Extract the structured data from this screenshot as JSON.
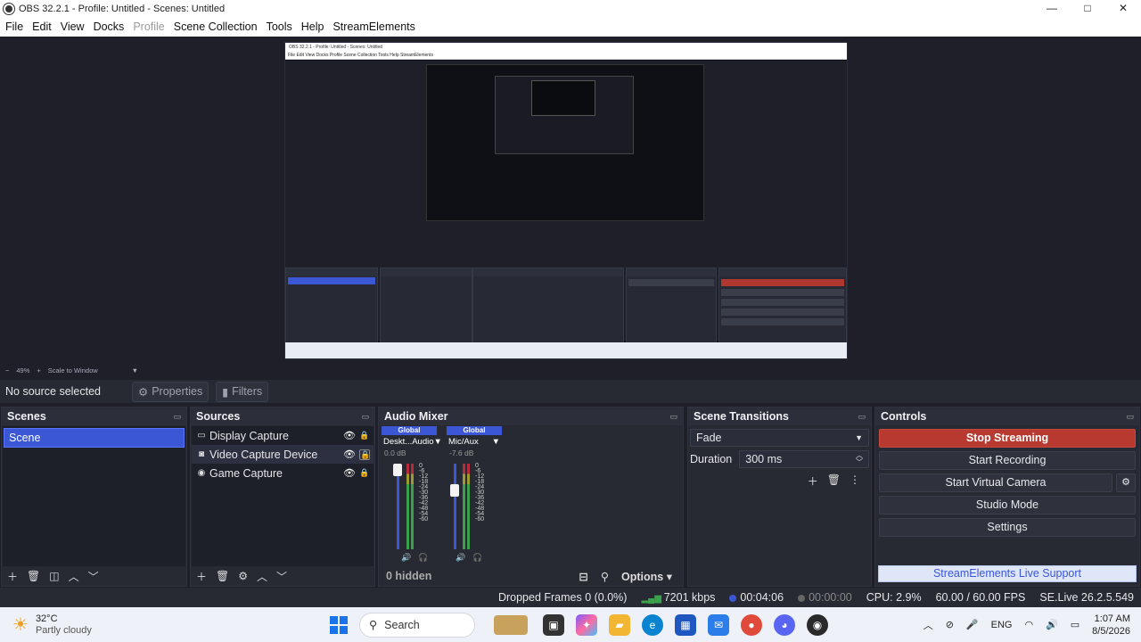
{
  "window": {
    "title": "OBS 32.2.1 - Profile: Untitled - Scenes: Untitled",
    "minimize": "—",
    "maximize": "□",
    "close": "✕"
  },
  "menu": [
    "File",
    "Edit",
    "View",
    "Docks",
    "Profile",
    "Scene Collection",
    "Tools",
    "Help",
    "StreamElements"
  ],
  "preview": {
    "zoom": "49%",
    "scale_mode": "Scale to Window",
    "nested_title": "OBS 32.2.1 - Profile: Untitled - Scenes: Untitled",
    "nested_menu": "File  Edit  View  Docks  Profile  Scene Collection  Tools  Help  StreamElements"
  },
  "source_toolbar": {
    "no_source": "No source selected",
    "properties": "Properties",
    "filters": "Filters"
  },
  "scenes": {
    "title": "Scenes",
    "items": [
      "Scene"
    ]
  },
  "sources": {
    "title": "Sources",
    "items": [
      {
        "label": "Display Capture",
        "icon": "monitor-icon"
      },
      {
        "label": "Video Capture Device",
        "icon": "camera-icon"
      },
      {
        "label": "Game Capture",
        "icon": "gamepad-icon"
      }
    ]
  },
  "audio_mixer": {
    "title": "Audio Mixer",
    "channels": [
      {
        "global": "Global",
        "name": "Deskt...Audio",
        "db": "0.0 dB",
        "level": 1.0
      },
      {
        "global": "Global",
        "name": "Mic/Aux",
        "db": "-7.6 dB",
        "level": 0.72
      }
    ],
    "scale": [
      "0",
      "-6",
      "-12",
      "-18",
      "-24",
      "-30",
      "-36",
      "-42",
      "-48",
      "-54",
      "-60"
    ],
    "hidden": "0 hidden",
    "options": "Options"
  },
  "transitions": {
    "title": "Scene Transitions",
    "selected": "Fade",
    "duration_label": "Duration",
    "duration_value": "300 ms"
  },
  "controls": {
    "title": "Controls",
    "stop_streaming": "Stop Streaming",
    "start_recording": "Start Recording",
    "start_virtual_camera": "Start Virtual Camera",
    "studio_mode": "Studio Mode",
    "settings": "Settings",
    "se_support": "StreamElements Live Support"
  },
  "status": {
    "dropped_frames": "Dropped Frames 0 (0.0%)",
    "bitrate": "7201 kbps",
    "stream_time": "00:04:06",
    "rec_time": "00:00:00",
    "cpu": "CPU: 2.9%",
    "fps": "60.00 / 60.00 FPS",
    "version": "SE.Live 26.2.5.549"
  },
  "taskbar": {
    "temperature": "32°C",
    "weather": "Partly cloudy",
    "search": "Search",
    "language": "ENG",
    "time": "1:07 AM",
    "date": "8/5/2026"
  }
}
